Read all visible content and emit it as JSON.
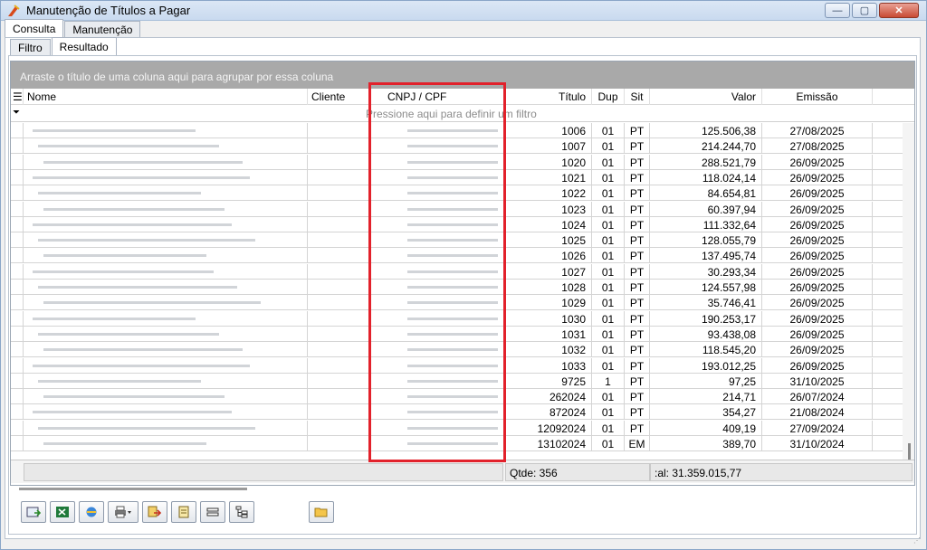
{
  "window": {
    "title": "Manutenção de Títulos a Pagar"
  },
  "tabs_top": [
    "Consulta",
    "Manutenção"
  ],
  "tabs_sub": [
    "Filtro",
    "Resultado"
  ],
  "grid": {
    "group_hint": "Arraste o título de uma coluna aqui para agrupar por essa coluna",
    "filter_hint": "Pressione aqui para definir um filtro",
    "columns": [
      "Nome",
      "Cliente",
      "CNPJ / CPF",
      "Título",
      "Dup",
      "Sit",
      "Valor",
      "Emissão"
    ],
    "rows": [
      {
        "titulo": "1006",
        "dup": "01",
        "sit": "PT",
        "valor": "125.506,38",
        "emissao": "27/08/2025"
      },
      {
        "titulo": "1007",
        "dup": "01",
        "sit": "PT",
        "valor": "214.244,70",
        "emissao": "27/08/2025"
      },
      {
        "titulo": "1020",
        "dup": "01",
        "sit": "PT",
        "valor": "288.521,79",
        "emissao": "26/09/2025"
      },
      {
        "titulo": "1021",
        "dup": "01",
        "sit": "PT",
        "valor": "118.024,14",
        "emissao": "26/09/2025"
      },
      {
        "titulo": "1022",
        "dup": "01",
        "sit": "PT",
        "valor": "84.654,81",
        "emissao": "26/09/2025"
      },
      {
        "titulo": "1023",
        "dup": "01",
        "sit": "PT",
        "valor": "60.397,94",
        "emissao": "26/09/2025"
      },
      {
        "titulo": "1024",
        "dup": "01",
        "sit": "PT",
        "valor": "111.332,64",
        "emissao": "26/09/2025"
      },
      {
        "titulo": "1025",
        "dup": "01",
        "sit": "PT",
        "valor": "128.055,79",
        "emissao": "26/09/2025"
      },
      {
        "titulo": "1026",
        "dup": "01",
        "sit": "PT",
        "valor": "137.495,74",
        "emissao": "26/09/2025"
      },
      {
        "titulo": "1027",
        "dup": "01",
        "sit": "PT",
        "valor": "30.293,34",
        "emissao": "26/09/2025"
      },
      {
        "titulo": "1028",
        "dup": "01",
        "sit": "PT",
        "valor": "124.557,98",
        "emissao": "26/09/2025"
      },
      {
        "titulo": "1029",
        "dup": "01",
        "sit": "PT",
        "valor": "35.746,41",
        "emissao": "26/09/2025"
      },
      {
        "titulo": "1030",
        "dup": "01",
        "sit": "PT",
        "valor": "190.253,17",
        "emissao": "26/09/2025"
      },
      {
        "titulo": "1031",
        "dup": "01",
        "sit": "PT",
        "valor": "93.438,08",
        "emissao": "26/09/2025"
      },
      {
        "titulo": "1032",
        "dup": "01",
        "sit": "PT",
        "valor": "118.545,20",
        "emissao": "26/09/2025"
      },
      {
        "titulo": "1033",
        "dup": "01",
        "sit": "PT",
        "valor": "193.012,25",
        "emissao": "26/09/2025"
      },
      {
        "titulo": "9725",
        "dup": "1",
        "sit": "PT",
        "valor": "97,25",
        "emissao": "31/10/2025"
      },
      {
        "titulo": "262024",
        "dup": "01",
        "sit": "PT",
        "valor": "214,71",
        "emissao": "26/07/2024"
      },
      {
        "titulo": "872024",
        "dup": "01",
        "sit": "PT",
        "valor": "354,27",
        "emissao": "21/08/2024"
      },
      {
        "titulo": "12092024",
        "dup": "01",
        "sit": "PT",
        "valor": "409,19",
        "emissao": "27/09/2024"
      },
      {
        "titulo": "13102024",
        "dup": "01",
        "sit": "EM",
        "valor": "389,70",
        "emissao": "31/10/2024"
      }
    ],
    "footer": {
      "qtde": "Qtde: 356",
      "total": ":al: 31.359.015,77"
    }
  },
  "colors": {
    "highlight_box": "#e2212b",
    "group_bar": "#a9a9a9"
  },
  "toolbar_icons": [
    "new-record-icon",
    "excel-icon",
    "browser-icon",
    "print-icon",
    "export-icon",
    "document-icon",
    "layout-icon",
    "tree-icon",
    "folder-icon"
  ]
}
